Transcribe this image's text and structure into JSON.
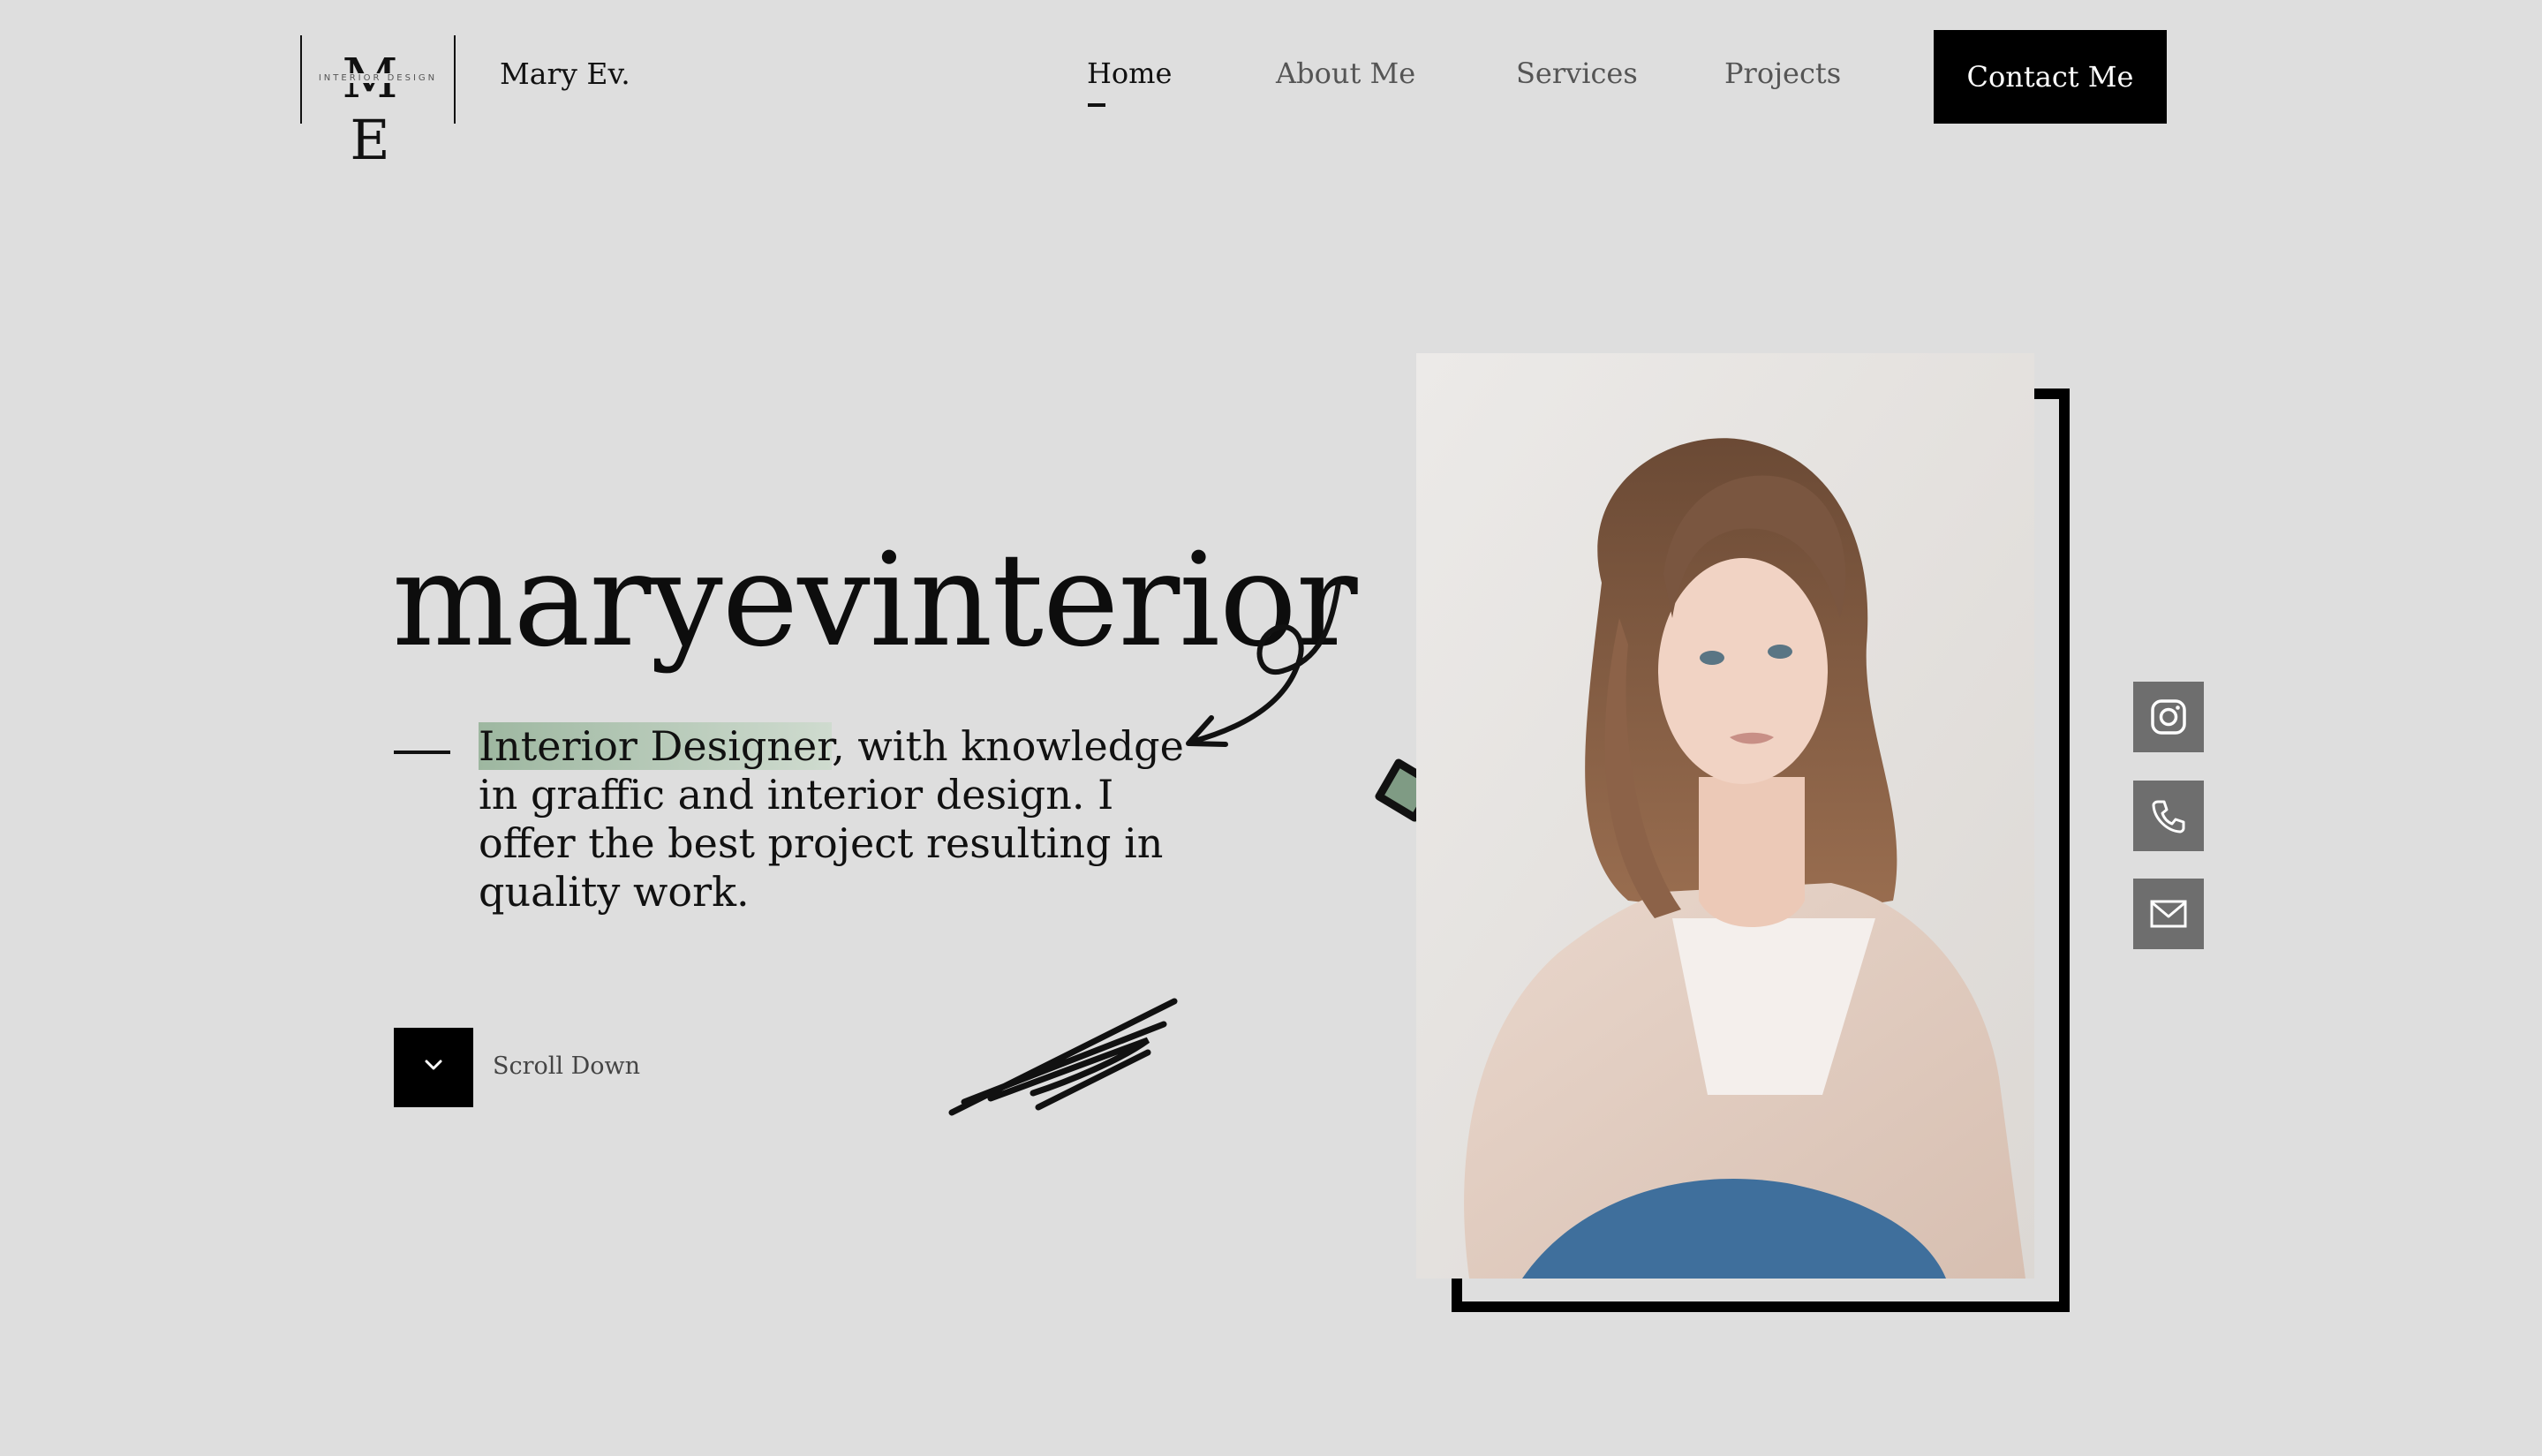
{
  "header": {
    "logo_letters": "M E",
    "logo_tagline": "INTERIOR DESIGN",
    "brand_name": "Mary Ev.",
    "nav": [
      {
        "label": "Home",
        "active": true
      },
      {
        "label": "About Me",
        "active": false
      },
      {
        "label": "Services",
        "active": false
      },
      {
        "label": "Projects",
        "active": false
      }
    ],
    "cta_label": "Contact Me"
  },
  "hero": {
    "title": "maryevinterior",
    "tagline_highlight": "Interior Designer",
    "tagline_rest": ", with knowledge in graffic and interior design. I offer the best project resulting in quality work.",
    "scroll_label": "Scroll Down"
  },
  "social": [
    {
      "icon": "instagram-icon"
    },
    {
      "icon": "phone-icon"
    },
    {
      "icon": "mail-icon"
    }
  ],
  "colors": {
    "background": "#dedede",
    "accent": "#9db7a0",
    "dark": "#000000",
    "social_bg": "#6e6e6e"
  }
}
